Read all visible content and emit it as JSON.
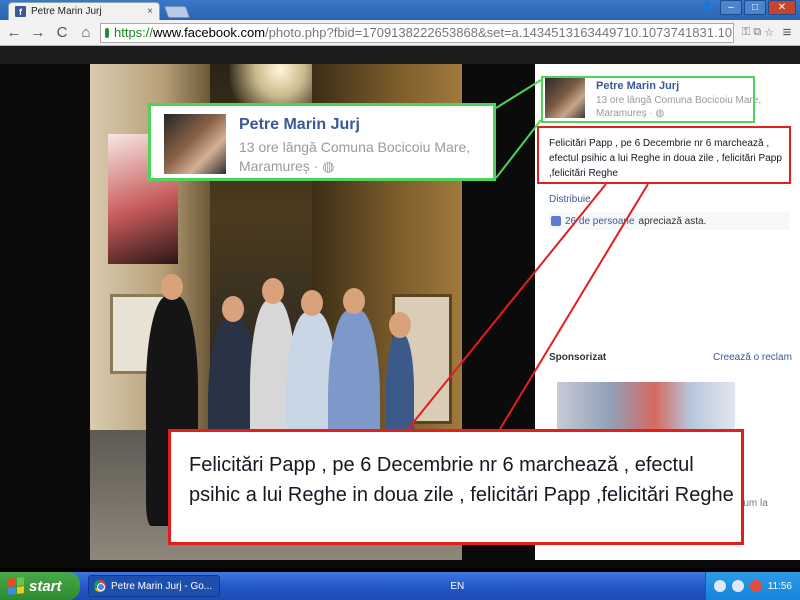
{
  "browser": {
    "tab_title": "Petre Marin Jurj",
    "tab_close": "×",
    "url_scheme": "https://",
    "url_host": "www.facebook.com",
    "url_rest": "/photo.php?fbid=1709138222653868&set=a.1434513163449710.1073741831.10",
    "back_icon": "←",
    "forward_icon": "→",
    "reload_icon": "C",
    "home_icon": "⌂",
    "star_icon": "☆",
    "menu_icon": "≡"
  },
  "window_controls": {
    "minimize": "–",
    "maximize": "□",
    "close": "✕"
  },
  "post": {
    "author": "Petre Marin Jurj",
    "meta": "13 ore lângă Comuna Bocicoiu Mare, Maramureș · ◍",
    "text": "Felicitări Papp , pe 6 Decembrie nr 6 marchează , efectul psihic a lui Reghe in doua zile , felicitări Papp ,felicitări Reghe",
    "share": "Distribuie",
    "likes_count": "26 de persoane",
    "likes_tail": "apreciază asta."
  },
  "sidebar": {
    "sponsored": "Sponsorizat",
    "create_ad": "Creează o reclam",
    "tail_text": "i, acum la"
  },
  "callouts": {
    "green_author": "Petre Marin Jurj",
    "green_meta": "13 ore lângă Comuna Bocicoiu Mare, Maramureș · ◍",
    "red_text": "Felicitări Papp , pe 6 Decembrie nr 6 marchează , efectul psihic a lui Reghe in doua zile , felicitări Papp ,felicitări Reghe"
  },
  "taskbar": {
    "start": "start",
    "task": "Petre Marin Jurj - Go...",
    "lang": "EN",
    "clock": "11:56"
  },
  "colors": {
    "fb_blue": "#3b5998",
    "callout_green": "#4fd35a",
    "callout_red": "#e21e1e"
  }
}
